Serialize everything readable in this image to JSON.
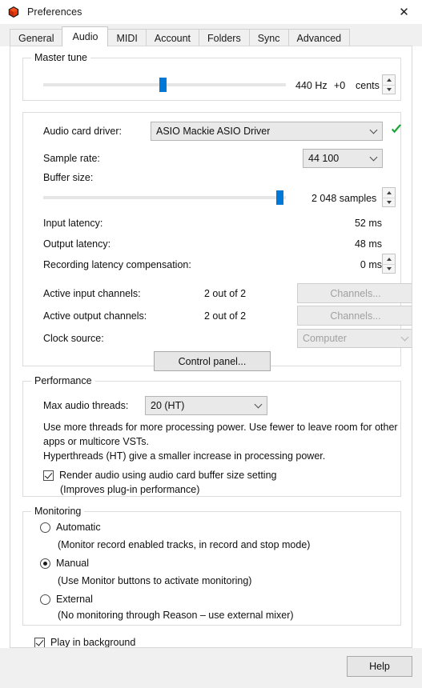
{
  "window": {
    "title": "Preferences",
    "icon": "reason-app-icon",
    "close_label": "✕"
  },
  "tabs": [
    {
      "label": "General",
      "selected": false
    },
    {
      "label": "Audio",
      "selected": true
    },
    {
      "label": "MIDI",
      "selected": false
    },
    {
      "label": "Account",
      "selected": false
    },
    {
      "label": "Folders",
      "selected": false
    },
    {
      "label": "Sync",
      "selected": false
    },
    {
      "label": "Advanced",
      "selected": false
    }
  ],
  "master_tune": {
    "title": "Master tune",
    "frequency": "440 Hz",
    "offset": "+0",
    "unit": "cents",
    "slider_percent": 50
  },
  "audio_card": {
    "driver_label": "Audio card driver:",
    "driver_value": "ASIO Mackie ASIO Driver",
    "driver_ok_icon": "green-check-icon",
    "sample_rate_label": "Sample rate:",
    "sample_rate_value": "44 100",
    "buffer_size_label": "Buffer size:",
    "buffer_size_value": "2 048 samples",
    "buffer_slider_percent": 96,
    "input_latency_label": "Input latency:",
    "input_latency_value": "52 ms",
    "output_latency_label": "Output latency:",
    "output_latency_value": "48 ms",
    "rec_latency_label": "Recording latency compensation:",
    "rec_latency_value": "0 ms",
    "active_input_label": "Active input channels:",
    "active_input_value": "2 out of 2",
    "active_output_label": "Active output channels:",
    "active_output_value": "2 out of 2",
    "channels_button": "Channels...",
    "clock_source_label": "Clock source:",
    "clock_source_value": "Computer",
    "control_panel_button": "Control panel..."
  },
  "performance": {
    "title": "Performance",
    "max_threads_label": "Max audio threads:",
    "max_threads_value": "20 (HT)",
    "description_line1": "Use more threads for more processing power. Use fewer to leave room for other",
    "description_line2": "apps or multicore VSTs.",
    "description_line3": "Hyperthreads (HT) give a smaller increase in processing power.",
    "render_checkbox_label": "Render audio using audio card buffer size setting",
    "render_checkbox_checked": true,
    "render_sublabel": "(Improves plug-in performance)"
  },
  "monitoring": {
    "title": "Monitoring",
    "options": [
      {
        "label": "Automatic",
        "selected": false,
        "description": "(Monitor record enabled tracks, in record and stop mode)"
      },
      {
        "label": "Manual",
        "selected": true,
        "description": "(Use Monitor buttons to activate monitoring)"
      },
      {
        "label": "External",
        "selected": false,
        "description": "(No monitoring through Reason – use external mixer)"
      }
    ]
  },
  "play_in_background": {
    "label": "Play in background",
    "checked": true
  },
  "footer": {
    "help_label": "Help"
  },
  "colors": {
    "accent_blue": "#0078d7",
    "ok_green": "#1fa539",
    "panel_bg": "#ffffff",
    "dialog_bg": "#f0f0f0"
  }
}
